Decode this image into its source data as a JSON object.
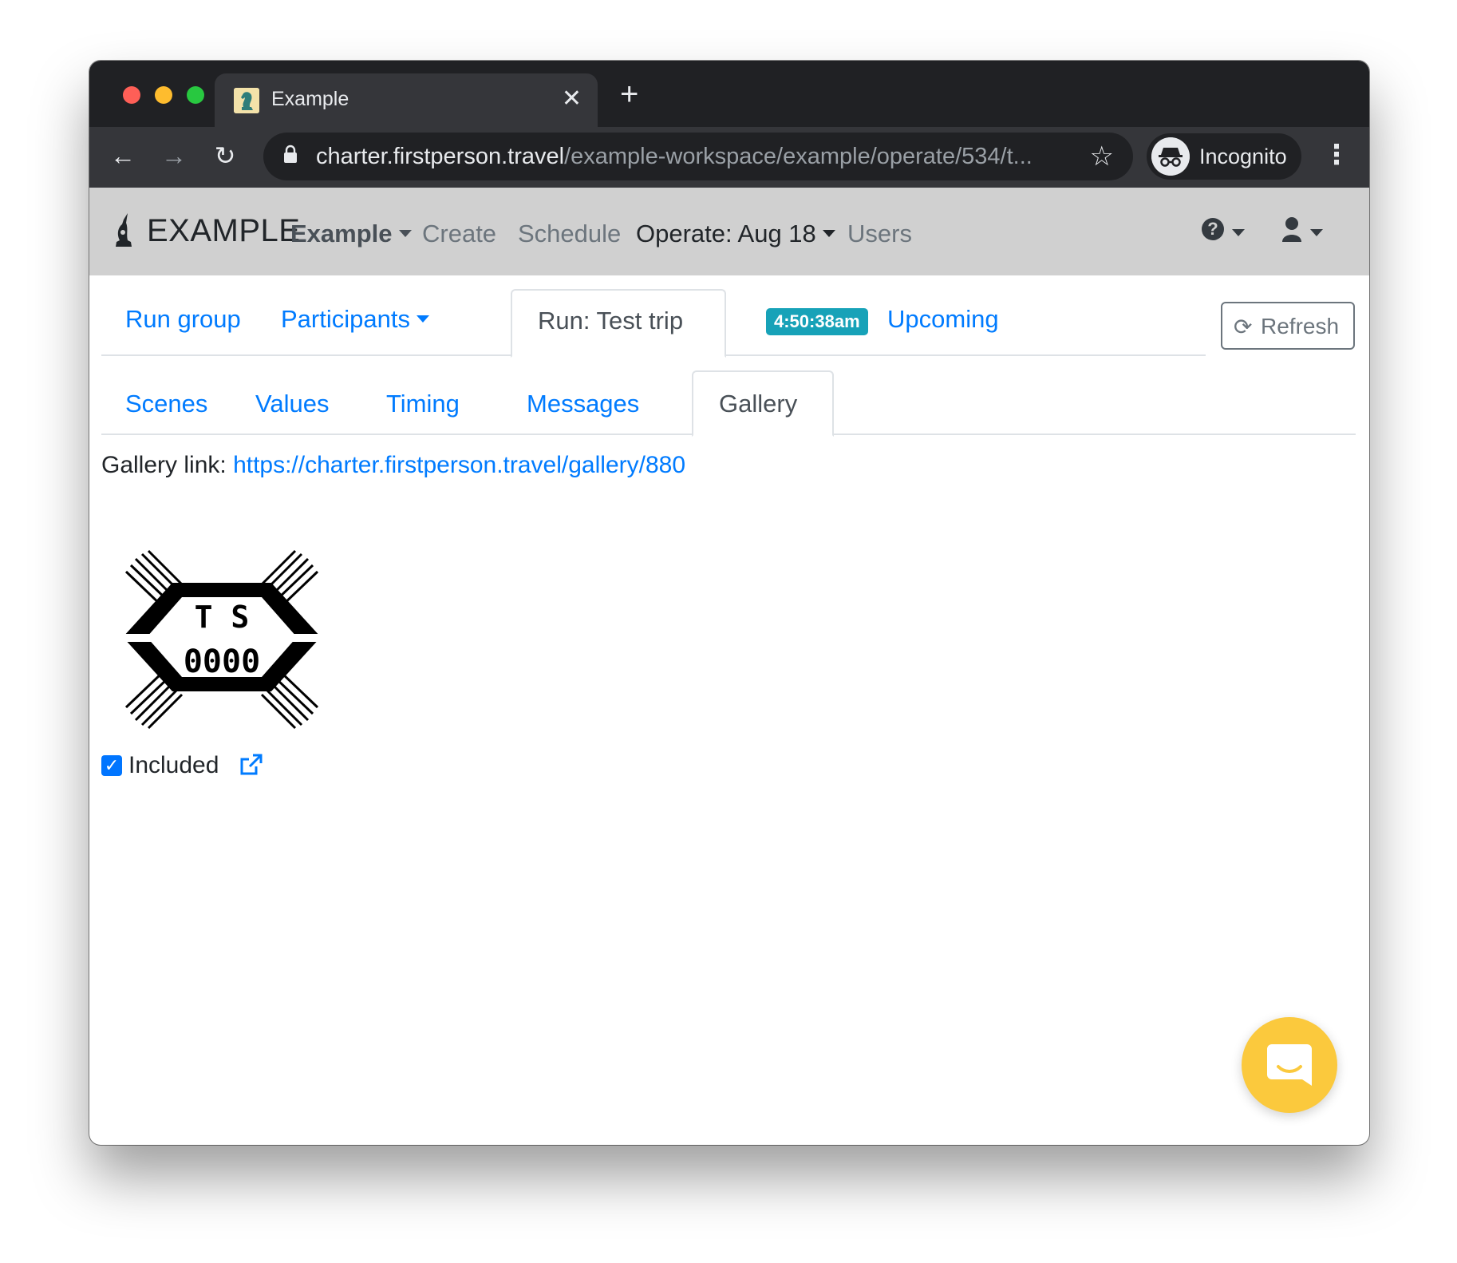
{
  "browser": {
    "tab_title": "Example",
    "tab_close": "✕",
    "new_tab": "+",
    "url_host": "charter.firstperson.travel",
    "url_path": "/example-workspace/example/operate/534/t...",
    "profile_label": "Incognito",
    "back_glyph": "←",
    "forward_glyph": "→",
    "reload_glyph": "↻",
    "star_glyph": "☆",
    "menu_glyph": "⋮"
  },
  "navbar": {
    "brand": "EXAMPLE",
    "links": {
      "workspace": "Example",
      "create": "Create",
      "schedule": "Schedule",
      "operate": "Operate: Aug 18",
      "users": "Users"
    },
    "help_glyph": "?"
  },
  "primary_tabs": {
    "run_group": "Run group",
    "participants": "Participants",
    "run": "Run: Test trip",
    "time_badge": "4:50:38am",
    "upcoming": "Upcoming"
  },
  "refresh_button": {
    "label": "Refresh",
    "icon_glyph": "⟳"
  },
  "secondary_tabs": {
    "scenes": "Scenes",
    "values": "Values",
    "timing": "Timing",
    "messages": "Messages",
    "gallery": "Gallery"
  },
  "gallery": {
    "link_label": "Gallery link:",
    "link_url": "https://charter.firstperson.travel/gallery/880",
    "image_text_top": "T S",
    "image_text_bottom": "0000",
    "included_label": "Included",
    "included_checked": true
  },
  "colors": {
    "link": "#007bff",
    "badge": "#17a2b8",
    "navbar_bg": "#d0d0d0",
    "chat_fab": "#fbc93d"
  }
}
